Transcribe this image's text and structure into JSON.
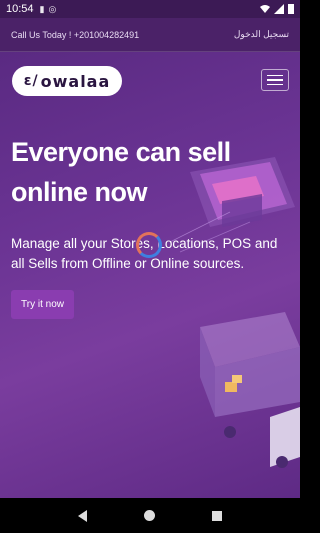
{
  "status_bar": {
    "time": "10:54"
  },
  "top_bar": {
    "phone_text": "Call Us Today ! +201004282491",
    "login_text": "تسجيل الدخول"
  },
  "logo": {
    "text": "owalaa",
    "mark": "ɛ/"
  },
  "hero": {
    "headline": "Everyone can sell online now",
    "subtext": "Manage all your Stores, Locations, POS and all Sells from Offline or Online sources.",
    "cta_label": "Try it now"
  },
  "colors": {
    "hero_top": "#5a2a82",
    "topbar": "#4b2268",
    "cta": "#8a3db0",
    "spinner_a": "#e2735a",
    "spinner_b": "#3f7fe0"
  }
}
